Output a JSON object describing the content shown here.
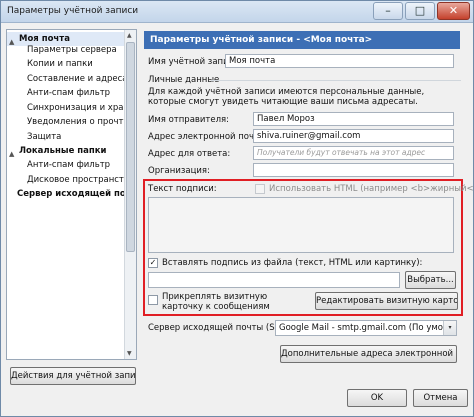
{
  "window": {
    "title": "Параметры учётной записи",
    "minimize_glyph": "–",
    "maximize_glyph": "□",
    "close_glyph": "✕"
  },
  "sidebar": {
    "items": [
      {
        "label": "Моя почта",
        "level": 0,
        "expander": "▲"
      },
      {
        "label": "Параметры сервера",
        "level": 1
      },
      {
        "label": "Копии и папки",
        "level": 1
      },
      {
        "label": "Составление и адресация",
        "level": 1
      },
      {
        "label": "Анти-спам фильтр",
        "level": 1
      },
      {
        "label": "Синхронизация и хранение",
        "level": 1
      },
      {
        "label": "Уведомления о прочтении",
        "level": 1
      },
      {
        "label": "Защита",
        "level": 1
      },
      {
        "label": "Локальные папки",
        "level": 0,
        "expander": "▲"
      },
      {
        "label": "Анти-спам фильтр",
        "level": 1
      },
      {
        "label": "Дисковое пространство",
        "level": 1
      },
      {
        "label": "Сервер исходящей почт...",
        "level": 0
      }
    ],
    "actions_button": "Действия для учётной записи",
    "actions_arrow": "▾"
  },
  "main": {
    "header": "Параметры учётной записи - <Моя почта>",
    "account_name_label": "Имя учётной записи:",
    "account_name_value": "Моя почта",
    "personal_section": "Личные данные",
    "personal_desc": "Для каждой учётной записи имеются персональные данные, которые смогут увидеть читающие ваши письма адресаты.",
    "sender_name_label": "Имя отправителя:",
    "sender_name_value": "Павел Мороз",
    "email_label": "Адрес электронной почты:",
    "email_value": "shiva.ruiner@gmail.com",
    "reply_to_label": "Адрес для ответа:",
    "reply_to_placeholder": "Получатели будут отвечать на этот адрес",
    "organization_label": "Организация:",
    "organization_value": "",
    "signature_label": "Текст подписи:",
    "use_html_label": "Использовать HTML (например <b>жирный</b>)",
    "use_html_checked": false,
    "attach_file_label": "Вставлять подпись из файла (текст, HTML или картинку):",
    "attach_file_checked": true,
    "attach_file_check_glyph": "✓",
    "browse_button": "Выбрать...",
    "attach_vcard_label": "Прикреплять визитную карточку к сообщениям",
    "attach_vcard_checked": false,
    "edit_vcard_button": "Редактировать визитную карточку...",
    "smtp_label": "Сервер исходящей почты (SMTP):",
    "smtp_value": "Google Mail - smtp.gmail.com (По умолча...",
    "smtp_arrow": "▾",
    "extra_addresses_button": "Дополнительные адреса электронной почты...",
    "ok_button": "OK",
    "cancel_button": "Отмена"
  }
}
